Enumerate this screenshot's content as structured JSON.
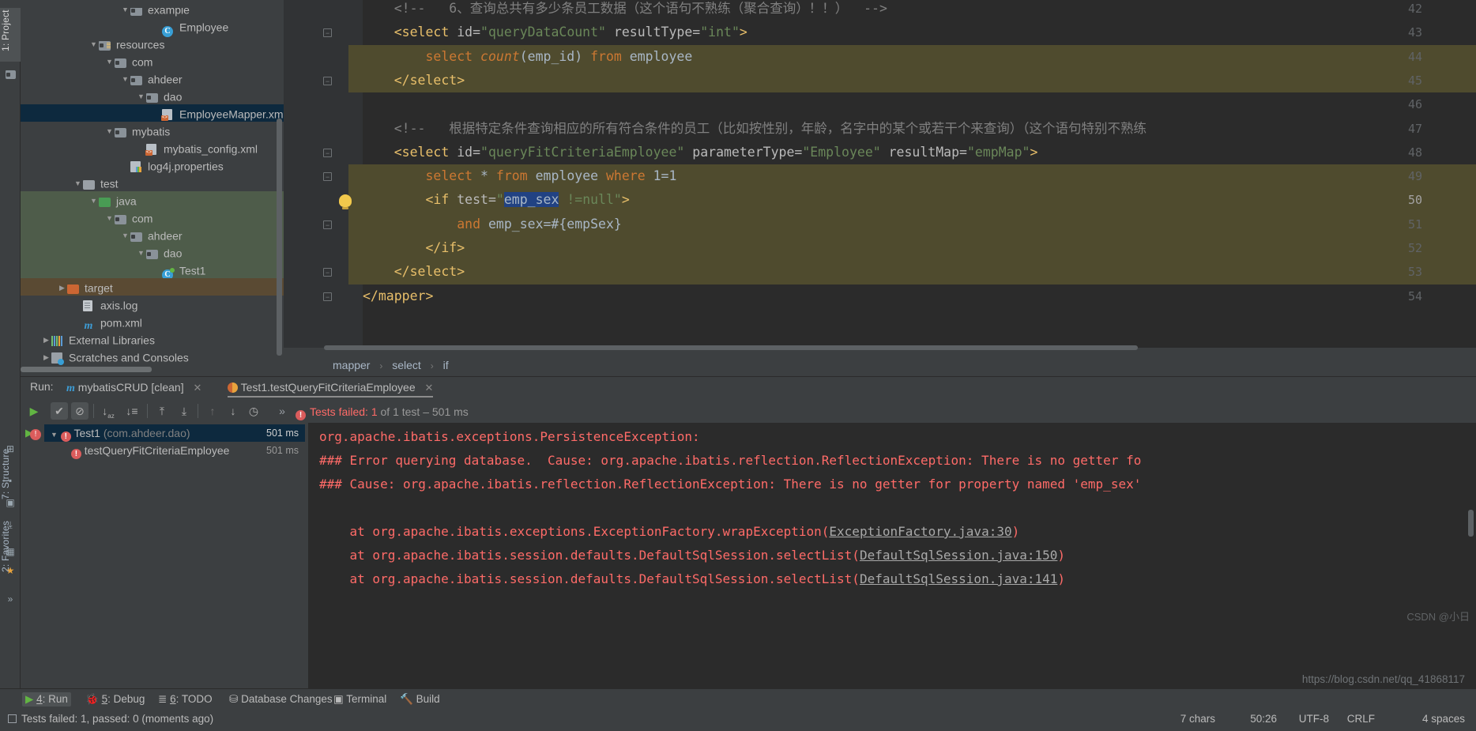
{
  "toolwindows": {
    "left_vertical": [
      {
        "label": "1: Project",
        "selected": true
      },
      {
        "label": "7: Structure",
        "selected": false
      },
      {
        "label": "2: Favorites",
        "selected": false
      }
    ]
  },
  "project_tree": {
    "title": "Project",
    "items": [
      {
        "indent": 6,
        "tri": "▼",
        "icon": "folder-icon",
        "label": "example",
        "state": "none"
      },
      {
        "indent": 8,
        "tri": "",
        "icon": "class-icon",
        "label": "Employee",
        "state": "none"
      },
      {
        "indent": 4,
        "tri": "▼",
        "icon": "folder-resources-icon",
        "label": "resources",
        "state": "none"
      },
      {
        "indent": 5,
        "tri": "▼",
        "icon": "folder-icon",
        "label": "com",
        "state": "none"
      },
      {
        "indent": 6,
        "tri": "▼",
        "icon": "folder-icon",
        "label": "ahdeer",
        "state": "none"
      },
      {
        "indent": 7,
        "tri": "▼",
        "icon": "folder-icon",
        "label": "dao",
        "state": "none"
      },
      {
        "indent": 8,
        "tri": "",
        "icon": "xml-file-icon",
        "label": "EmployeeMapper.xml",
        "state": "selected"
      },
      {
        "indent": 5,
        "tri": "▼",
        "icon": "folder-icon",
        "label": "mybatis",
        "state": "none"
      },
      {
        "indent": 7,
        "tri": "",
        "icon": "xml-file-icon",
        "label": "mybatis_config.xml",
        "state": "none"
      },
      {
        "indent": 6,
        "tri": "",
        "icon": "properties-file-icon",
        "label": "log4j.properties",
        "state": "none"
      },
      {
        "indent": 3,
        "tri": "▼",
        "icon": "folder-plain-icon",
        "label": "test",
        "state": "none"
      },
      {
        "indent": 4,
        "tri": "▼",
        "icon": "folder-green-icon",
        "label": "java",
        "state": "source"
      },
      {
        "indent": 5,
        "tri": "▼",
        "icon": "folder-icon",
        "label": "com",
        "state": "source"
      },
      {
        "indent": 6,
        "tri": "▼",
        "icon": "folder-icon",
        "label": "ahdeer",
        "state": "source"
      },
      {
        "indent": 7,
        "tri": "▼",
        "icon": "folder-icon",
        "label": "dao",
        "state": "source"
      },
      {
        "indent": 8,
        "tri": "",
        "icon": "test-class-icon",
        "label": "Test1",
        "state": "source"
      },
      {
        "indent": 2,
        "tri": "▶",
        "icon": "folder-orange-icon",
        "label": "target",
        "state": "excluded"
      },
      {
        "indent": 3,
        "tri": "",
        "icon": "log-file-icon",
        "label": "axis.log",
        "state": "none"
      },
      {
        "indent": 3,
        "tri": "",
        "icon": "maven-icon",
        "label": "pom.xml",
        "state": "none"
      },
      {
        "indent": 1,
        "tri": "▶",
        "icon": "libraries-icon",
        "label": "External Libraries",
        "state": "none"
      },
      {
        "indent": 1,
        "tri": "▶",
        "icon": "scratches-icon",
        "label": "Scratches and Consoles",
        "state": "none"
      }
    ]
  },
  "editor": {
    "lines": [
      {
        "no": "42",
        "fold": "",
        "cur": false,
        "highlight": false,
        "segments": [
          {
            "t": "    ",
            "c": "plain"
          },
          {
            "t": "<!--   6、查询总共有多少条员工数据（这个语句不熟练（聚合查询）！！）  -->",
            "c": "cmt"
          }
        ]
      },
      {
        "no": "43",
        "fold": "minus",
        "cur": false,
        "highlight": false,
        "segments": [
          {
            "t": "    ",
            "c": "plain"
          },
          {
            "t": "<select",
            "c": "kw"
          },
          {
            "t": " id=",
            "c": "attr"
          },
          {
            "t": "\"queryDataCount\"",
            "c": "str"
          },
          {
            "t": " resultType=",
            "c": "attr"
          },
          {
            "t": "\"int\"",
            "c": "str"
          },
          {
            "t": ">",
            "c": "kw"
          }
        ]
      },
      {
        "no": "44",
        "fold": "",
        "cur": false,
        "highlight": true,
        "segments": [
          {
            "t": "        ",
            "c": "plain"
          },
          {
            "t": "select ",
            "c": "sql-kw"
          },
          {
            "t": "count",
            "c": "sql-fn"
          },
          {
            "t": "(emp_id) ",
            "c": "plain"
          },
          {
            "t": "from",
            "c": "sql-kw"
          },
          {
            "t": " employee",
            "c": "plain"
          }
        ]
      },
      {
        "no": "45",
        "fold": "minus2",
        "cur": false,
        "highlight": true,
        "segments": [
          {
            "t": "    ",
            "c": "plain"
          },
          {
            "t": "</select>",
            "c": "kw"
          }
        ]
      },
      {
        "no": "46",
        "fold": "",
        "cur": false,
        "highlight": false,
        "segments": [
          {
            "t": "",
            "c": "plain"
          }
        ]
      },
      {
        "no": "47",
        "fold": "",
        "cur": false,
        "highlight": false,
        "segments": [
          {
            "t": "    ",
            "c": "plain"
          },
          {
            "t": "<!--   根据特定条件查询相应的所有符合条件的员工（比如按性别，年龄，名字中的某个或若干个来查询）（这个语句特别不熟练",
            "c": "cmt"
          }
        ]
      },
      {
        "no": "48",
        "fold": "minus",
        "cur": false,
        "highlight": false,
        "segments": [
          {
            "t": "    ",
            "c": "plain"
          },
          {
            "t": "<select",
            "c": "kw"
          },
          {
            "t": " id=",
            "c": "attr"
          },
          {
            "t": "\"queryFitCriteriaEmployee\"",
            "c": "str"
          },
          {
            "t": " parameterType=",
            "c": "attr"
          },
          {
            "t": "\"Employee\"",
            "c": "str"
          },
          {
            "t": " resultMap=",
            "c": "attr"
          },
          {
            "t": "\"empMap\"",
            "c": "str"
          },
          {
            "t": ">",
            "c": "kw"
          }
        ]
      },
      {
        "no": "49",
        "fold": "minus",
        "cur": false,
        "highlight": true,
        "segments": [
          {
            "t": "        ",
            "c": "plain"
          },
          {
            "t": "select ",
            "c": "sql-kw"
          },
          {
            "t": "* ",
            "c": "plain"
          },
          {
            "t": "from",
            "c": "sql-kw"
          },
          {
            "t": " employee ",
            "c": "plain"
          },
          {
            "t": "where",
            "c": "sql-kw"
          },
          {
            "t": " 1=1",
            "c": "plain"
          }
        ]
      },
      {
        "no": "50",
        "fold": "bulb",
        "cur": true,
        "highlight": true,
        "segments": [
          {
            "t": "        ",
            "c": "plain"
          },
          {
            "t": "<if",
            "c": "kw"
          },
          {
            "t": " test=",
            "c": "attr"
          },
          {
            "t": "\"",
            "c": "str"
          },
          {
            "t": "emp_sex",
            "c": "sel-tok"
          },
          {
            "t": " !=null\"",
            "c": "str"
          },
          {
            "t": ">",
            "c": "kw"
          }
        ]
      },
      {
        "no": "51",
        "fold": "minus2",
        "cur": false,
        "highlight": true,
        "segments": [
          {
            "t": "            ",
            "c": "plain"
          },
          {
            "t": "and",
            "c": "sql-kw"
          },
          {
            "t": " emp_sex=#{empSex}",
            "c": "plain"
          }
        ]
      },
      {
        "no": "52",
        "fold": "",
        "cur": false,
        "highlight": true,
        "segments": [
          {
            "t": "        ",
            "c": "plain"
          },
          {
            "t": "</if>",
            "c": "kw"
          }
        ]
      },
      {
        "no": "53",
        "fold": "minus2",
        "cur": false,
        "highlight": true,
        "segments": [
          {
            "t": "    ",
            "c": "plain"
          },
          {
            "t": "</select>",
            "c": "kw"
          }
        ]
      },
      {
        "no": "54",
        "fold": "minus2",
        "cur": false,
        "highlight": false,
        "segments": [
          {
            "t": "",
            "c": "plain"
          },
          {
            "t": "</mapper>",
            "c": "kw"
          }
        ]
      }
    ],
    "breadcrumbs": [
      "mapper",
      "select",
      "if"
    ]
  },
  "run_panel": {
    "label": "Run:",
    "tabs": [
      {
        "label": "mybatisCRUD [clean]",
        "icon": "maven-icon",
        "active": false,
        "close": "✕"
      },
      {
        "label": "Test1.testQueryFitCriteriaEmployee",
        "icon": "junit-icon",
        "active": true,
        "close": "✕"
      }
    ],
    "toolbar_buttons": [
      {
        "name": "rerun-button",
        "glyph": "▶"
      },
      {
        "name": "show-passed-toggle",
        "glyph": "✔"
      },
      {
        "name": "show-ignored-toggle",
        "glyph": "⊘"
      },
      {
        "name": "sort-alphabetically-button",
        "glyph": "↓"
      },
      {
        "name": "sort-by-duration-button",
        "glyph": "↓"
      },
      {
        "name": "expand-all-button",
        "glyph": "⤒"
      },
      {
        "name": "collapse-all-button",
        "glyph": "⤓"
      },
      {
        "name": "prev-failed-button",
        "glyph": "↑"
      },
      {
        "name": "next-failed-button",
        "glyph": "↓"
      },
      {
        "name": "history-button",
        "glyph": "◷"
      },
      {
        "name": "more-options-button",
        "glyph": "»"
      }
    ],
    "status": {
      "prefix": "Tests failed:",
      "count": "1",
      "suffix": "of 1 test – 501 ms"
    },
    "test_tree": [
      {
        "tri": "▼",
        "label": "Test1",
        "pkg": "(com.ahdeer.dao)",
        "time": "501 ms",
        "selected": true,
        "indent": 0
      },
      {
        "tri": "",
        "label": "testQueryFitCriteriaEmployee",
        "pkg": "",
        "time": "501 ms",
        "selected": false,
        "indent": 1
      }
    ],
    "console_lines": [
      {
        "text": "org.apache.ibatis.exceptions.PersistenceException:",
        "link": ""
      },
      {
        "text": "### Error querying database.  Cause: org.apache.ibatis.reflection.ReflectionException: There is no getter fo",
        "link": ""
      },
      {
        "text": "### Cause: org.apache.ibatis.reflection.ReflectionException: There is no getter for property named 'emp_sex'",
        "link": ""
      },
      {
        "text": "",
        "link": ""
      },
      {
        "text": "    at org.apache.ibatis.exceptions.ExceptionFactory.wrapException(",
        "link": "ExceptionFactory.java:30",
        "after": ")"
      },
      {
        "text": "    at org.apache.ibatis.session.defaults.DefaultSqlSession.selectList(",
        "link": "DefaultSqlSession.java:150",
        "after": ")"
      },
      {
        "text": "    at org.apache.ibatis.session.defaults.DefaultSqlSession.selectList(",
        "link": "DefaultSqlSession.java:141",
        "after": ")"
      }
    ]
  },
  "bottom_tool_bar": {
    "items": [
      {
        "num": "4",
        "label": ": Run",
        "icon": "run-icon",
        "selected": true
      },
      {
        "num": "5",
        "label": ": Debug",
        "icon": "debug-icon",
        "selected": false
      },
      {
        "num": "6",
        "label": ": TODO",
        "icon": "todo-icon",
        "selected": false
      },
      {
        "num": "",
        "label": "Database Changes",
        "icon": "database-icon",
        "selected": false
      },
      {
        "num": "",
        "label": "Terminal",
        "icon": "terminal-icon",
        "selected": false
      },
      {
        "num": "",
        "label": "Build",
        "icon": "build-icon",
        "selected": false
      }
    ]
  },
  "status_bar": {
    "message": "Tests failed: 1, passed: 0 (moments ago)",
    "chars": "7 chars",
    "caret": "50:26",
    "encoding": "UTF-8",
    "line_sep": "CRLF",
    "indent": "4 spaces"
  },
  "watermark": "https://blog.csdn.net/qq_41868117",
  "watermark2": "CSDN @小日"
}
